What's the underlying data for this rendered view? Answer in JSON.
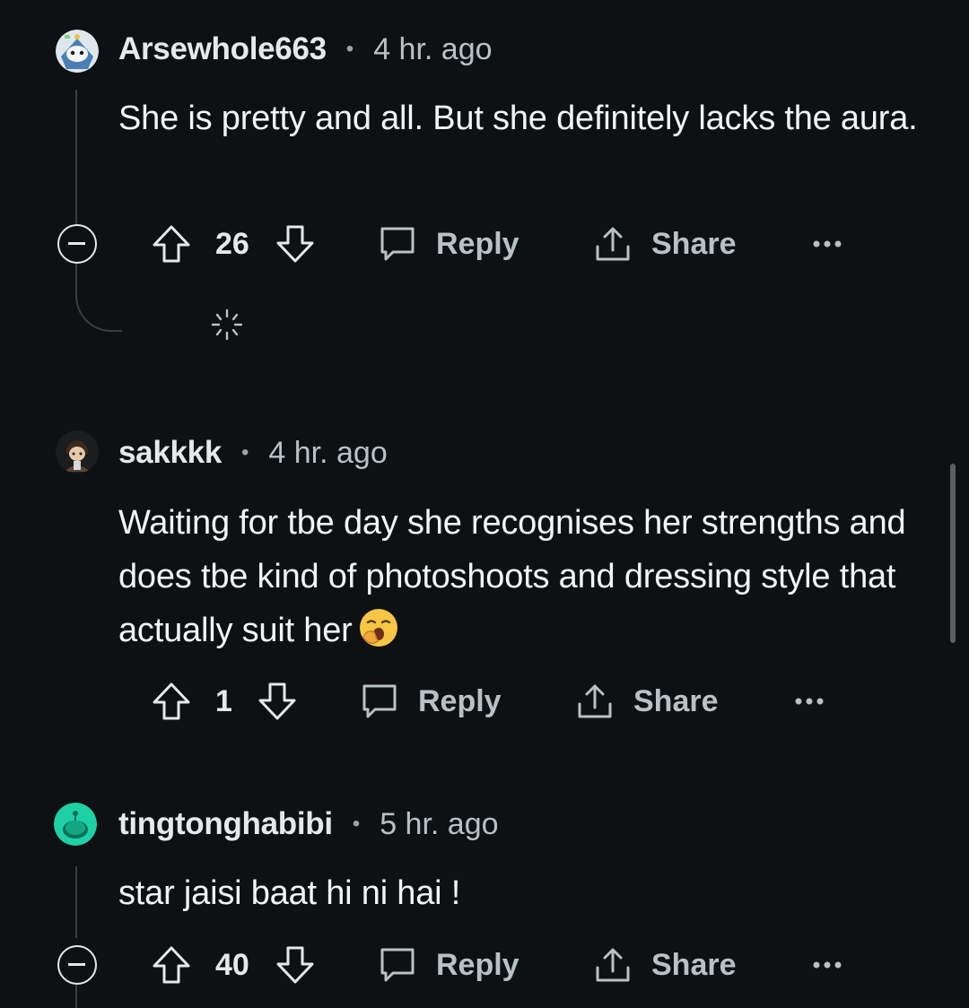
{
  "comments": [
    {
      "username": "Arsewhole663",
      "separator": "•",
      "time": "4 hr. ago",
      "body": "She is pretty and all. But she definitely lacks the aura.",
      "score": "26",
      "reply_label": "Reply",
      "share_label": "Share",
      "avatar_icon": "snoo-robot-avatar-icon"
    },
    {
      "username": "sakkkk",
      "separator": "•",
      "time": "4 hr. ago",
      "body": "Waiting for tbe day she recognises her strengths and does tbe kind of photoshoots and dressing style that actually suit her",
      "emoji": "yawning-face-icon",
      "score": "1",
      "reply_label": "Reply",
      "share_label": "Share",
      "avatar_icon": "character-avatar-icon"
    },
    {
      "username": "tingtonghabibi",
      "separator": "•",
      "time": "5 hr. ago",
      "body": "star jaisi baat hi ni hai !",
      "score": "40",
      "reply_label": "Reply",
      "share_label": "Share",
      "avatar_icon": "teal-snoo-avatar-icon"
    }
  ],
  "colors": {
    "background": "#0e1113",
    "text": "#f2f4f5",
    "muted": "#b8c1c6",
    "thread_line": "#3a3f43",
    "avatar_teal": "#1ed1a5"
  }
}
